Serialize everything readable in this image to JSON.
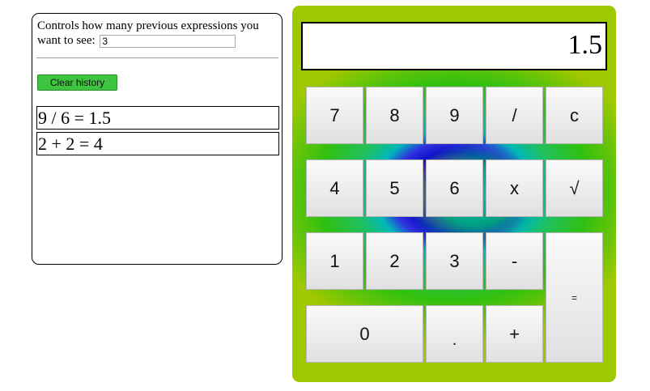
{
  "history_panel": {
    "controls_label": "Controls how many previous expressions you want to see:",
    "count_value": "3",
    "clear_label": "Clear history",
    "entries": [
      "9 / 6 = 1.5",
      "2 + 2 = 4"
    ]
  },
  "calculator": {
    "display": "1.5",
    "keys": {
      "k7": "7",
      "k8": "8",
      "k9": "9",
      "div": "/",
      "clear": "c",
      "k4": "4",
      "k5": "5",
      "k6": "6",
      "mul": "x",
      "sqrt": "√",
      "k1": "1",
      "k2": "2",
      "k3": "3",
      "sub": "-",
      "eq": "=",
      "k0": "0",
      "dot": ".",
      "add": "+"
    },
    "colors": {
      "outer": "#a0c800",
      "green": "#30c010",
      "cyan": "#00b8b8",
      "blue": "#1010c8",
      "magenta": "#d4007a",
      "clear_button": "#3ec43e"
    }
  }
}
